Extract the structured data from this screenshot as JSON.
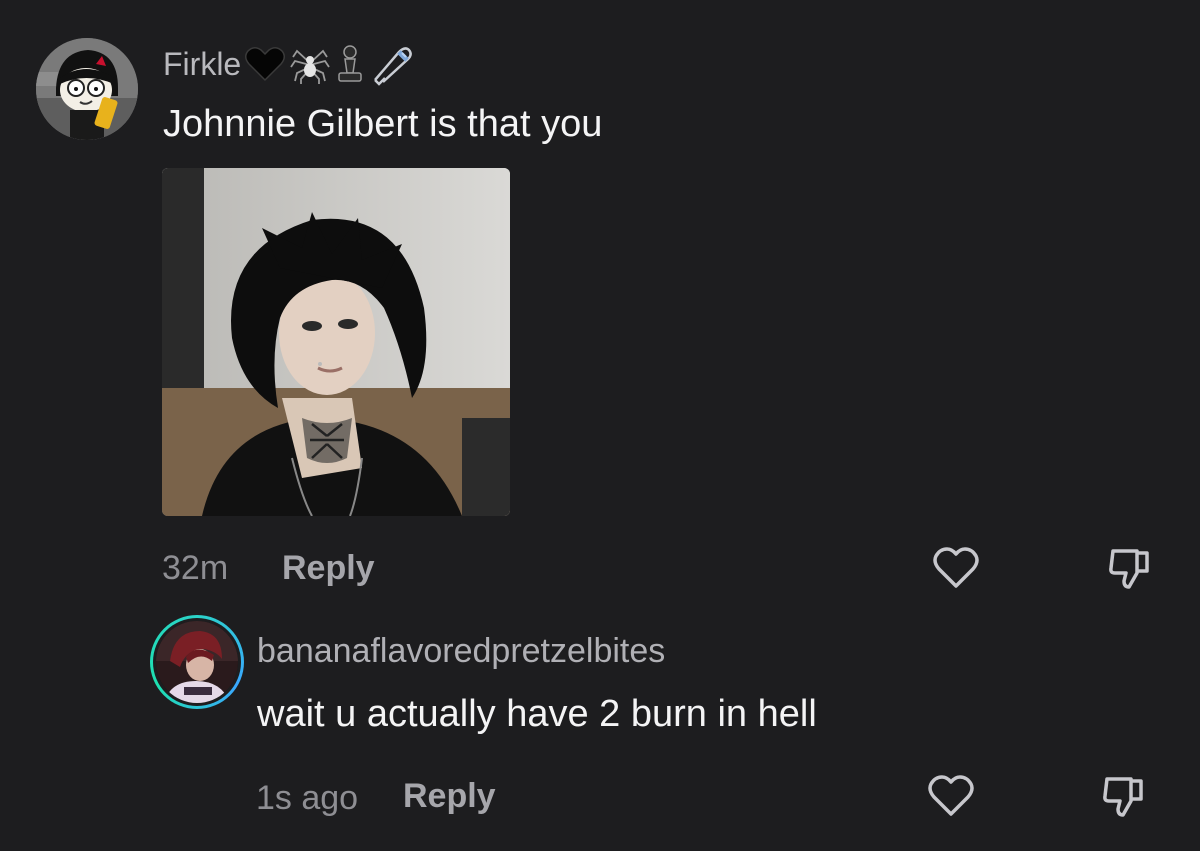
{
  "comment": {
    "username": "Firkle",
    "badges": [
      "black-heart-icon",
      "spider-icon",
      "chess-pawn-icon",
      "safety-pin-icon"
    ],
    "text": "Johnnie Gilbert is that you",
    "timestamp": "32m",
    "reply_label": "Reply",
    "like_icon": "heart-outline-icon",
    "dislike_icon": "thumbs-down-icon"
  },
  "reply": {
    "username": "bananaflavoredpretzelbites",
    "text": "wait u actually have 2 burn in hell",
    "timestamp": "1s ago",
    "reply_label": "Reply",
    "like_icon": "heart-outline-icon",
    "dislike_icon": "thumbs-down-icon",
    "avatar_ring_colors": [
      "#2bd3c8",
      "#3aa7ff",
      "#1ee0b0"
    ]
  },
  "colors": {
    "background": "#1d1d1f",
    "primary_text": "#f4f4f5",
    "secondary_text": "#8e8e93",
    "icon": "#c7c7cc"
  }
}
